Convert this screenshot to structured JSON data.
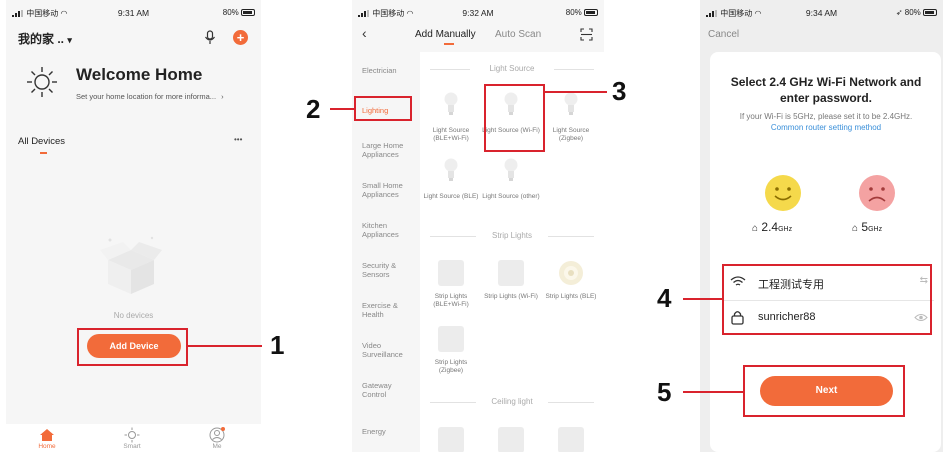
{
  "screen1": {
    "status": {
      "carrier": "中国移动",
      "time": "9:31 AM",
      "battery": "80%"
    },
    "home_name": "我的家 ..",
    "welcome_title": "Welcome Home",
    "welcome_subtitle": "Set your home location for more informa...",
    "all_devices": "All Devices",
    "more": "•••",
    "empty_text": "No devices",
    "add_device": "Add Device",
    "tabs": {
      "home": "Home",
      "smart": "Smart",
      "me": "Me"
    },
    "accent": "#f26b3a"
  },
  "screen2": {
    "status": {
      "carrier": "中国移动",
      "time": "9:32 AM",
      "battery": "80%"
    },
    "tab_manual": "Add Manually",
    "tab_auto": "Auto Scan",
    "categories": [
      "Electrician",
      "Lighting",
      "Large Home Appliances",
      "Small Home Appliances",
      "Kitchen Appliances",
      "Security & Sensors",
      "Exercise & Health",
      "Video Surveillance",
      "Gateway Control",
      "Energy"
    ],
    "sections": {
      "light_source": "Light Source",
      "strip_lights": "Strip Lights",
      "ceiling_light": "Ceiling light"
    },
    "light_tiles": [
      "Light Source (BLE+Wi-Fi)",
      "Light Source (Wi-Fi)",
      "Light Source (Zigbee)",
      "Light Source (BLE)",
      "Light Source (other)"
    ],
    "strip_tiles": [
      "Strip Lights (BLE+Wi-Fi)",
      "Strip Lights (Wi-Fi)",
      "Strip Lights (BLE)",
      "Strip Lights (Zigbee)"
    ]
  },
  "screen3": {
    "status": {
      "carrier": "中国移动",
      "time": "9:34 AM",
      "battery": "80%"
    },
    "cancel": "Cancel",
    "title": "Select 2.4 GHz Wi-Fi Network and enter password.",
    "hint": "If your Wi-Fi is 5GHz, please set it to be 2.4GHz.",
    "hint_link": "Common router setting method",
    "band_24": "2.4",
    "band_5": "5",
    "ghz": "GHz",
    "wifi_name": "工程测试专用",
    "password": "sunricher88",
    "next": "Next",
    "link_color": "#3a8fd9"
  },
  "callouts": [
    "1",
    "2",
    "3",
    "4",
    "5"
  ]
}
